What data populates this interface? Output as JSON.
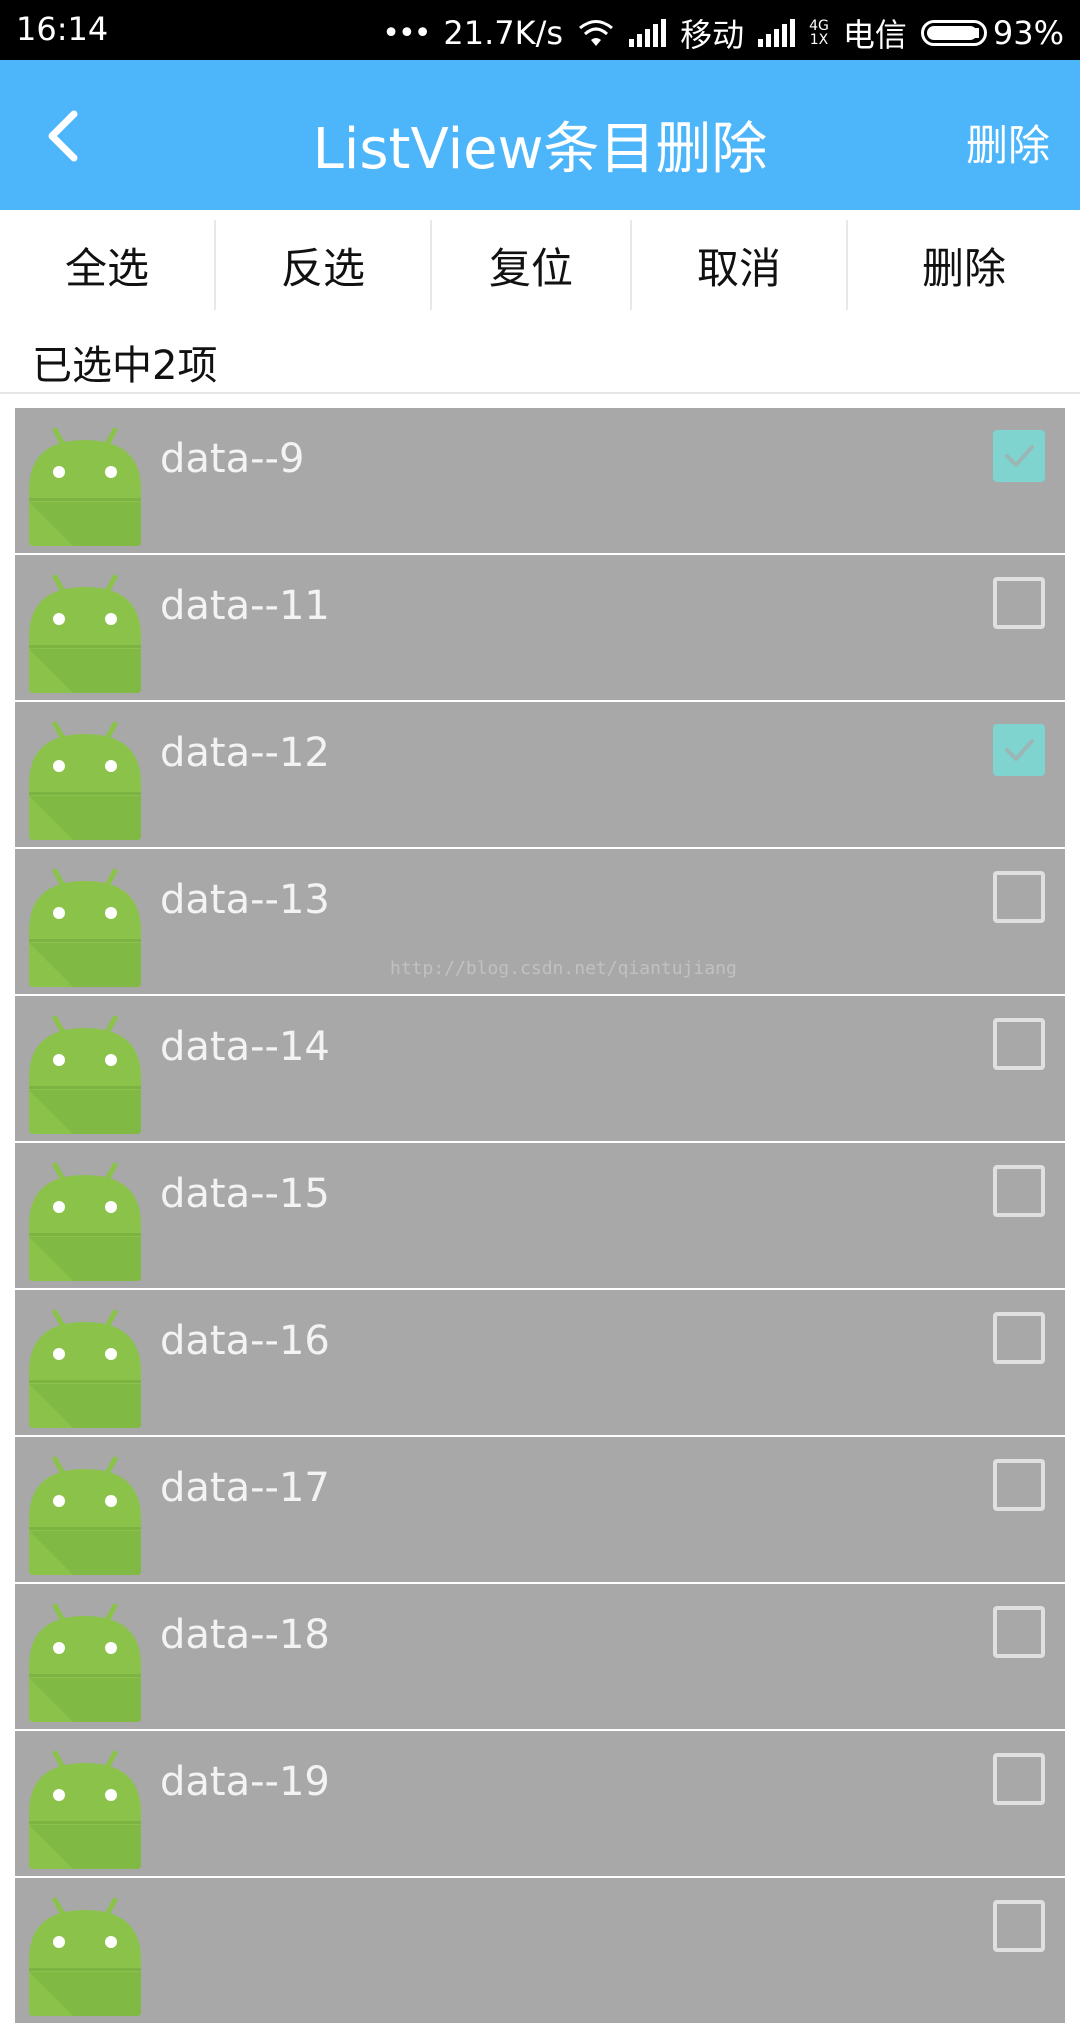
{
  "status_bar": {
    "time": "16:14",
    "dots": "•••",
    "speed": "21.7K/s",
    "carrier1": "移动",
    "net_top": "4G",
    "net_bottom": "1X",
    "carrier2": "电信",
    "battery": "93%",
    "battery_level": 0.93
  },
  "toolbar": {
    "title": "ListView条目删除",
    "action": "删除",
    "background": "#4db6fa"
  },
  "actions": [
    {
      "label": "全选"
    },
    {
      "label": "反选"
    },
    {
      "label": "复位"
    },
    {
      "label": "取消"
    },
    {
      "label": "删除"
    }
  ],
  "selection": {
    "count_text": "已选中2项"
  },
  "list": {
    "items": [
      {
        "label": "data--9",
        "checked": true
      },
      {
        "label": "data--11",
        "checked": false
      },
      {
        "label": "data--12",
        "checked": true
      },
      {
        "label": "data--13",
        "checked": false
      },
      {
        "label": "data--14",
        "checked": false
      },
      {
        "label": "data--15",
        "checked": false
      },
      {
        "label": "data--16",
        "checked": false
      },
      {
        "label": "data--17",
        "checked": false
      },
      {
        "label": "data--18",
        "checked": false
      },
      {
        "label": "data--19",
        "checked": false
      },
      {
        "label": "",
        "checked": false
      }
    ],
    "icon": "android-robot-icon",
    "row_color": "#a8a8a8",
    "check_color": "#7fd4d0"
  },
  "watermark": "http://blog.csdn.net/qiantujiang"
}
